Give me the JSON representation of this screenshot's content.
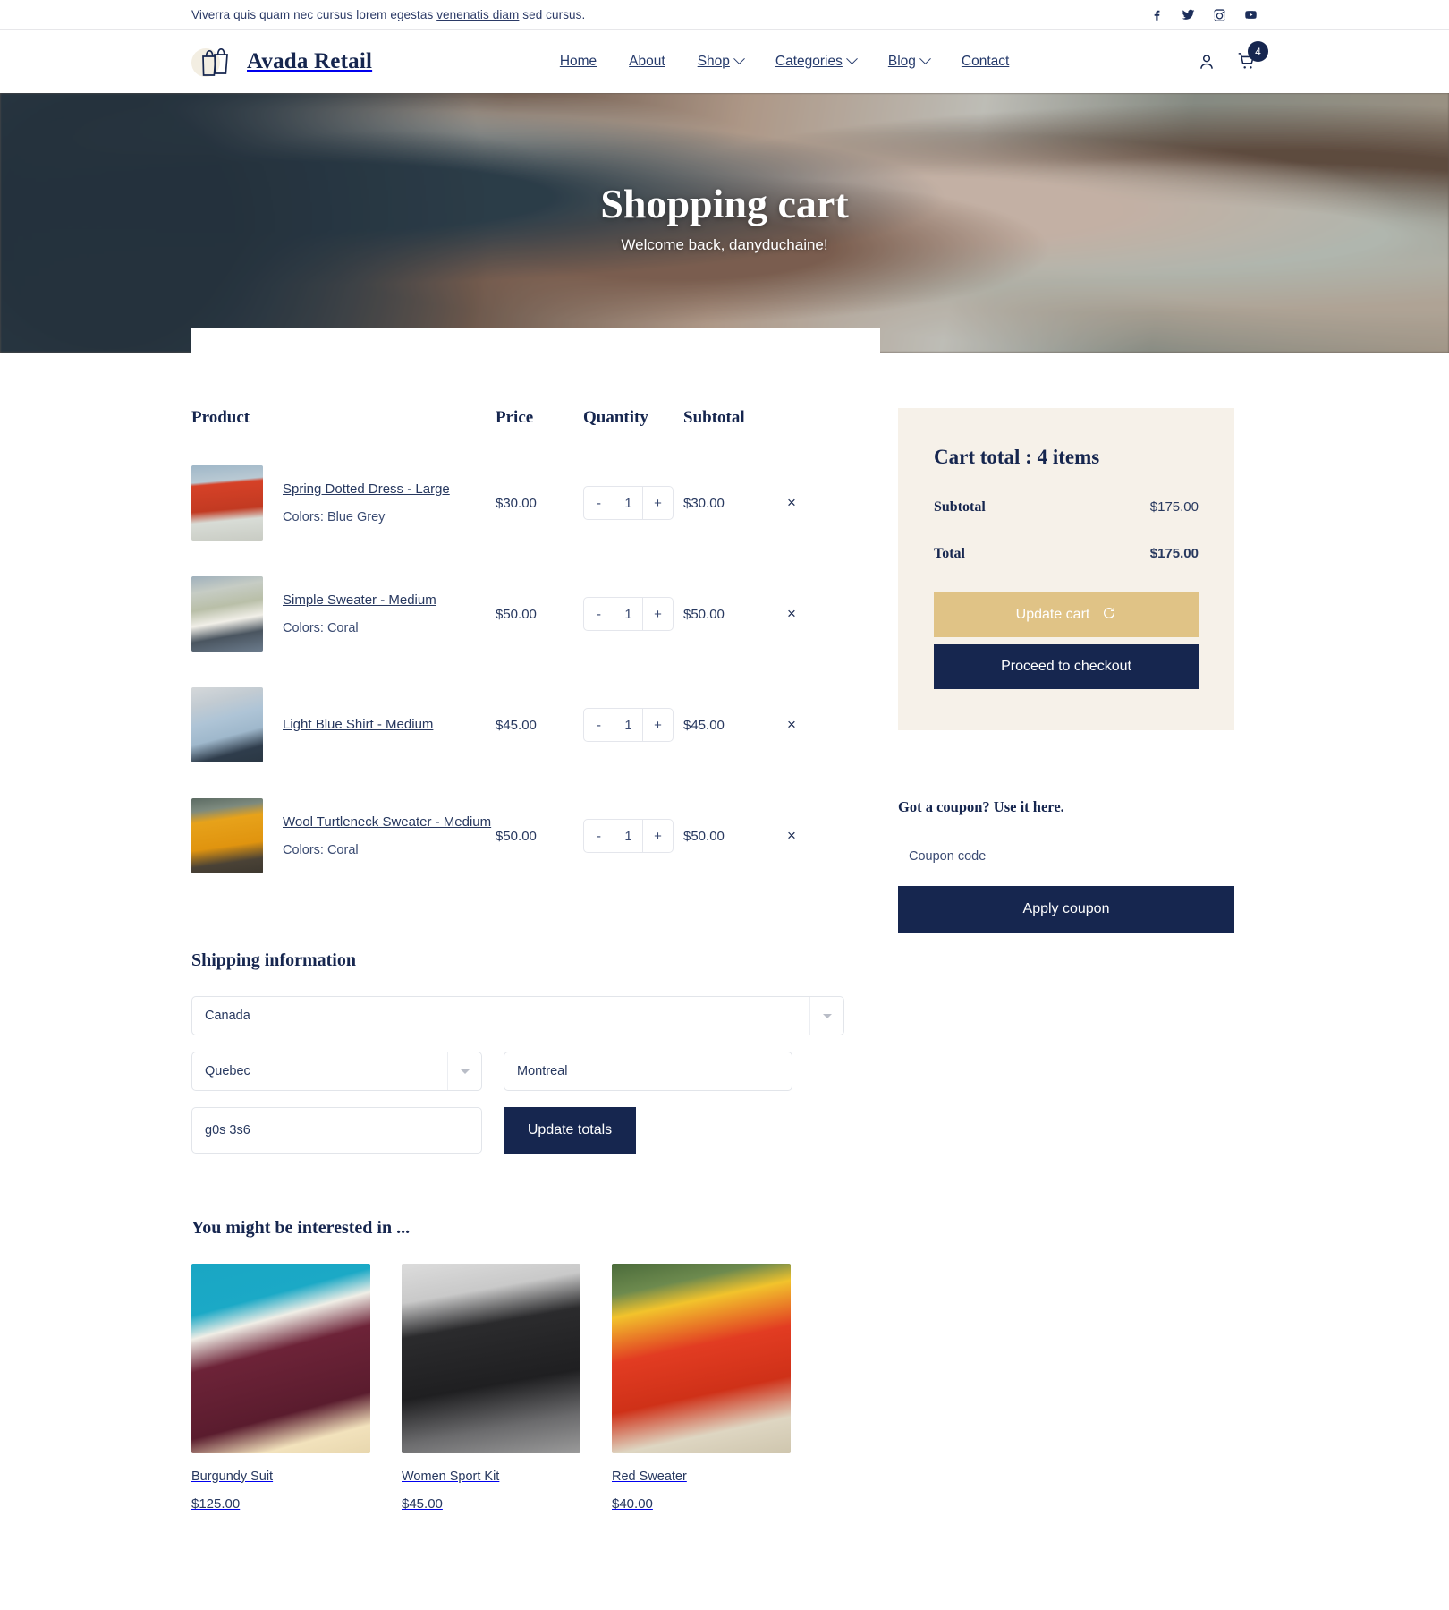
{
  "topbar": {
    "text_before": "Viverra quis quam nec cursus lorem egestas ",
    "link": "venenatis diam",
    "text_after": " sed cursus.",
    "socials": [
      {
        "name": "facebook-icon",
        "label": "f"
      },
      {
        "name": "twitter-icon",
        "label": "t"
      },
      {
        "name": "instagram-icon",
        "label": "i"
      },
      {
        "name": "youtube-icon",
        "label": "y"
      }
    ]
  },
  "header": {
    "brand": "Avada Retail",
    "nav": [
      {
        "label": "Home",
        "caret": false
      },
      {
        "label": "About",
        "caret": false
      },
      {
        "label": "Shop",
        "caret": true
      },
      {
        "label": "Categories",
        "caret": true
      },
      {
        "label": "Blog",
        "caret": true
      },
      {
        "label": "Contact",
        "caret": false
      }
    ],
    "account_icon": "user-icon",
    "cart_icon": "cart-icon",
    "cart_count": "4"
  },
  "hero": {
    "title": "Shopping cart",
    "subtitle": "Welcome back, danyduchaine!"
  },
  "cart": {
    "columns": {
      "product": "Product",
      "price": "Price",
      "quantity": "Quantity",
      "subtotal": "Subtotal"
    },
    "items": [
      {
        "name": "Spring Dotted Dress - Large",
        "colors": "Colors: Blue Grey",
        "price": "$30.00",
        "qty": "1",
        "subtotal": "$30.00",
        "minus": "-",
        "plus": "+",
        "remove": "×"
      },
      {
        "name": "Simple Sweater - Medium",
        "colors": "Colors: Coral",
        "price": "$50.00",
        "qty": "1",
        "subtotal": "$50.00",
        "minus": "-",
        "plus": "+",
        "remove": "×"
      },
      {
        "name": "Light Blue Shirt - Medium",
        "colors": "",
        "price": "$45.00",
        "qty": "1",
        "subtotal": "$45.00",
        "minus": "-",
        "plus": "+",
        "remove": "×"
      },
      {
        "name": "Wool Turtleneck Sweater - Medium",
        "colors": "Colors: Coral",
        "price": "$50.00",
        "qty": "1",
        "subtotal": "$50.00",
        "minus": "-",
        "plus": "+",
        "remove": "×"
      }
    ]
  },
  "shipping": {
    "title": "Shipping information",
    "country": "Canada",
    "state": "Quebec",
    "city": "Montreal",
    "postal": "g0s 3s6",
    "update_totals": "Update totals"
  },
  "recommendations": {
    "title": "You might be interested in ...",
    "items": [
      {
        "name": "Burgundy Suit",
        "price": "$125.00"
      },
      {
        "name": "Women Sport Kit",
        "price": "$45.00"
      },
      {
        "name": "Red Sweater",
        "price": "$40.00"
      }
    ]
  },
  "totals": {
    "title": "Cart total : 4 items",
    "subtotal_label": "Subtotal",
    "subtotal_value": "$175.00",
    "total_label": "Total",
    "total_value": "$175.00",
    "update_cart": "Update cart",
    "update_cart_icon": "refresh-icon",
    "checkout": "Proceed to checkout"
  },
  "coupon": {
    "title": "Got a coupon? Use it here.",
    "placeholder": "Coupon code",
    "value": "",
    "apply": "Apply coupon"
  },
  "colors": {
    "navy": "#16264f",
    "gold": "#e0c386",
    "cream": "#f6f1e9"
  }
}
